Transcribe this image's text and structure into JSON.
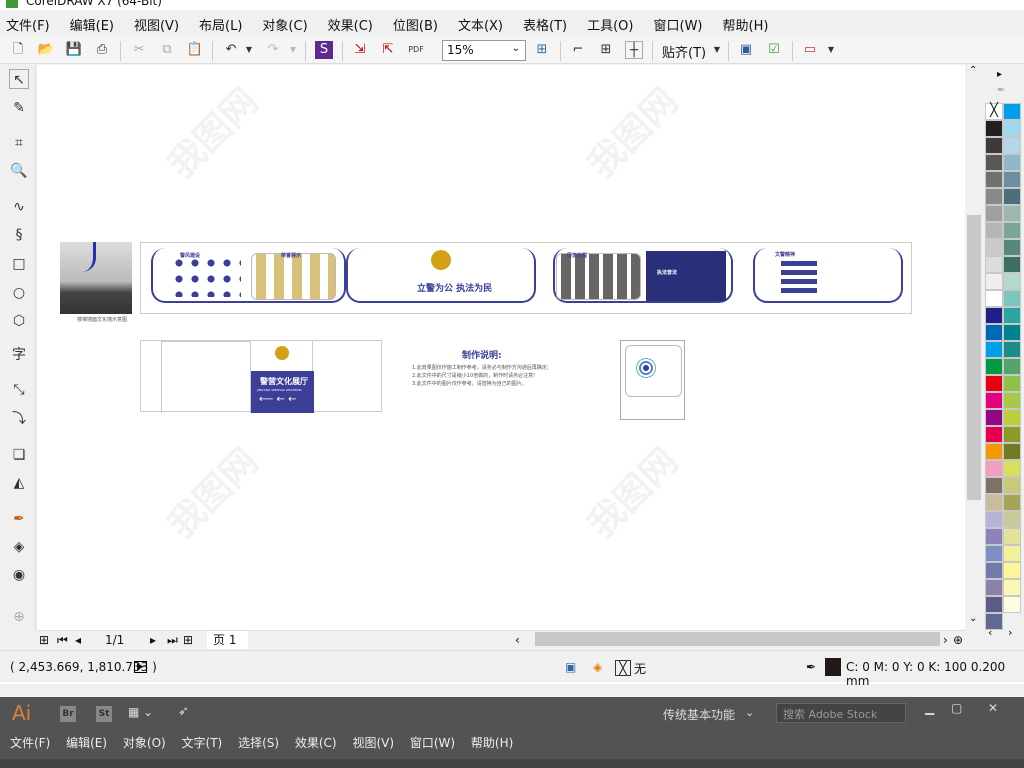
{
  "title": "CorelDRAW X7 (64-Bit)",
  "menu": [
    "文件(F)",
    "编辑(E)",
    "视图(V)",
    "布局(L)",
    "对象(C)",
    "效果(C)",
    "位图(B)",
    "文本(X)",
    "表格(T)",
    "工具(O)",
    "窗口(W)",
    "帮助(H)"
  ],
  "toolbar": {
    "zoom": "15%",
    "snap": "贴齐(T)"
  },
  "artwork": {
    "slogan": "立警为公  执法为民",
    "section1": "警风建设",
    "section2": "荣誉展示",
    "section3": "历史征程",
    "section4": "执法普法",
    "section5": "文警精神",
    "sign_title": "警营文化展厅",
    "sign_sub": "JINGYING WENHUA ZHANTING",
    "photo_caption": "楼梯墙面文化墙示意图",
    "notes_title": "制作说明:",
    "notes": [
      "1.此效果图仅作施工制作参考，请务必与制作方沟通后再确定;",
      "2.此文件中的尺寸是缩小10倍做的，制作时请务必注意!",
      "3.此文件中的图片仅作参考，请替换为自己的图片。"
    ]
  },
  "pagebar": {
    "page_count": "1/1",
    "page_tab": "页 1"
  },
  "status": {
    "coords": "( 2,453.669, 1,810.733 )",
    "fill": "无",
    "outline": "C: 0 M: 0 Y: 0 K: 100  0.200 mm"
  },
  "palette": {
    "left": [
      "#231f20",
      "#3e3a39",
      "#595757",
      "#727171",
      "#898989",
      "#9fa0a0",
      "#b5b5b6",
      "#c9caca",
      "#dcdddd",
      "#efefef",
      "#ffffff",
      "#1d2088",
      "#0068b7",
      "#00a0e9",
      "#009944",
      "#e60012",
      "#e4007f",
      "#920783",
      "#e5004f",
      "#f39800",
      "#f19ec2",
      "#7f7265",
      "#c9bc9c",
      "#b8b3d6",
      "#8f82bc",
      "#7e8fc4",
      "#6f7ba8",
      "#8c81a8",
      "#5b5b89",
      "#5e6a95"
    ],
    "right": [
      "#00a0e9",
      "#a0d8ef",
      "#b4d8e8",
      "#8fb8c8",
      "#6a8f9f",
      "#4d6e7c",
      "#9db8b0",
      "#7aa59a",
      "#57887b",
      "#3c6e61",
      "#b5d9d1",
      "#7cc6bf",
      "#2aa6a0",
      "#00838f",
      "#1b8c88",
      "#55a36b",
      "#8bc34a",
      "#a6c94b",
      "#bdcf3c",
      "#8c9a2a",
      "#6f7a22",
      "#d6e05e",
      "#c9c97a",
      "#a5a55a",
      "#c8c89a",
      "#e2e29a",
      "#f1f19b",
      "#fff599",
      "#fbf7b8",
      "#fffde0"
    ]
  },
  "ai": {
    "logo": "Ai",
    "br": "Br",
    "st": "St",
    "workspace": "传统基本功能",
    "search_placeholder": "搜索 Adobe Stock",
    "menu": [
      "文件(F)",
      "编辑(E)",
      "对象(O)",
      "文字(T)",
      "选择(S)",
      "效果(C)",
      "视图(V)",
      "窗口(W)",
      "帮助(H)"
    ]
  }
}
